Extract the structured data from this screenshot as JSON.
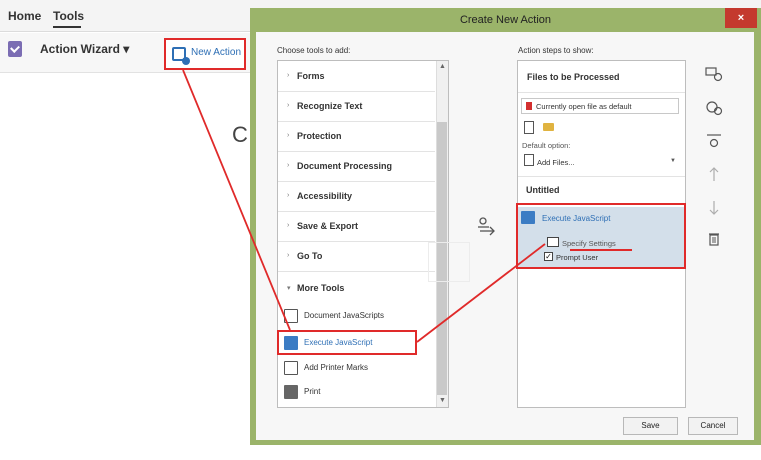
{
  "app": {
    "tabs": [
      "Home",
      "Tools"
    ],
    "action_wizard_label": "Action Wizard ▾",
    "new_action_label": "New Action",
    "bg_letter": "C"
  },
  "dialog": {
    "title": "Create New Action",
    "close_label": "×",
    "choose_label": "Choose tools to add:",
    "steps_label": "Action steps to show:",
    "categories": [
      "Forms",
      "Recognize Text",
      "Protection",
      "Document Processing",
      "Accessibility",
      "Save & Export",
      "Go To",
      "More Tools"
    ],
    "category_chevron": "›",
    "expanded_chevron": "▾",
    "more_tools_items": [
      "Document JavaScripts",
      "Execute JavaScript",
      "Add Printer Marks",
      "Print"
    ],
    "files_heading": "Files to be Processed",
    "files_dropdown_value": "Currently open file as default",
    "default_option_label": "Default option:",
    "add_files_label": "Add Files...",
    "untitled_label": "Untitled",
    "step_name": "Execute JavaScript",
    "specify_settings_label": "Specify Settings",
    "prompt_user_label": "Prompt User",
    "prompt_user_checked": true,
    "save_label": "Save",
    "cancel_label": "Cancel"
  },
  "colors": {
    "dialog_frame": "#9bb46a",
    "highlight_red": "#e02a2a",
    "link_blue": "#2e6fb5",
    "step_bg": "#d3dfea",
    "close_red": "#c4392e"
  },
  "icons": {
    "action_wizard": "checklist-icon",
    "new_action": "new-action-icon",
    "add_step": "arrow-right-icon",
    "side": [
      "add-panel-separator-icon",
      "add-instruction-icon",
      "insert-step-icon",
      "move-up-icon",
      "move-down-icon",
      "delete-icon"
    ]
  }
}
